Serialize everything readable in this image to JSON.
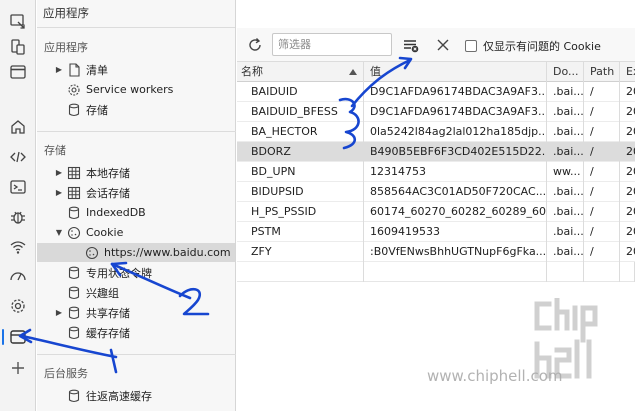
{
  "sidebar": {
    "header": "应用程序",
    "sections": [
      {
        "title": "应用程序",
        "items": [
          {
            "label": "清单",
            "icon": "file-icon",
            "arrow": "right"
          },
          {
            "label": "Service workers",
            "icon": "gear-icon",
            "arrow": ""
          },
          {
            "label": "存储",
            "icon": "database-icon",
            "arrow": ""
          }
        ]
      },
      {
        "title": "存储",
        "items": [
          {
            "label": "本地存储",
            "icon": "grid-icon",
            "arrow": "right"
          },
          {
            "label": "会话存储",
            "icon": "grid-icon",
            "arrow": "right"
          },
          {
            "label": "IndexedDB",
            "icon": "database-icon",
            "arrow": ""
          },
          {
            "label": "Cookie",
            "icon": "cookie-icon",
            "arrow": "down"
          },
          {
            "label": "https://www.baidu.com",
            "icon": "cookie-icon",
            "arrow": ""
          },
          {
            "label": "专用状态令牌",
            "icon": "database-icon",
            "arrow": ""
          },
          {
            "label": "兴趣组",
            "icon": "database-icon",
            "arrow": ""
          },
          {
            "label": "共享存储",
            "icon": "database-icon",
            "arrow": "right"
          },
          {
            "label": "缓存存储",
            "icon": "database-icon",
            "arrow": ""
          }
        ]
      },
      {
        "title": "后台服务",
        "items": [
          {
            "label": "往返高速缓存",
            "icon": "database-icon",
            "arrow": ""
          }
        ]
      }
    ]
  },
  "toolbar": {
    "filter_placeholder": "筛选器",
    "only_issues_label": "仅显示有问题的 Cookie"
  },
  "table": {
    "columns": [
      "名称",
      "值",
      "Do...",
      "Path",
      "Ex"
    ],
    "rows": [
      {
        "name": "BAIDUID",
        "value": "D9C1AFDA96174BDAC3A9AF3...",
        "domain": ".bai...",
        "path": "/",
        "expires": "20"
      },
      {
        "name": "BAIDUID_BFESS",
        "value": "D9C1AFDA96174BDAC3A9AF3...",
        "domain": ".bai...",
        "path": "/",
        "expires": "20"
      },
      {
        "name": "BA_HECTOR",
        "value": "0la5242l84ag2lal012ha185djp...",
        "domain": ".bai...",
        "path": "/",
        "expires": "20"
      },
      {
        "name": "BDORZ",
        "value": "B490B5EBF6F3CD402E515D22...",
        "domain": ".bai...",
        "path": "/",
        "expires": "20"
      },
      {
        "name": "BD_UPN",
        "value": "12314753",
        "domain": "ww...",
        "path": "/",
        "expires": "20"
      },
      {
        "name": "BIDUPSID",
        "value": "858564AC3C01AD50F720CAC...",
        "domain": ".bai...",
        "path": "/",
        "expires": "20"
      },
      {
        "name": "H_PS_PSSID",
        "value": "60174_60270_60282_60289_60...",
        "domain": ".bai...",
        "path": "/",
        "expires": "20"
      },
      {
        "name": "PSTM",
        "value": "1609419533",
        "domain": ".bai...",
        "path": "/",
        "expires": "20"
      },
      {
        "name": "ZFY",
        "value": ":B0VfENwsBhhUGTNupF6gFka...",
        "domain": ".bai...",
        "path": "/",
        "expires": "20"
      }
    ]
  },
  "annotations": {
    "label_1": "1",
    "label_2": "2",
    "label_3": "3",
    "color": "#1746d0"
  },
  "watermark": {
    "url": "www.chiphell.com",
    "logo_text": "chiphell"
  }
}
